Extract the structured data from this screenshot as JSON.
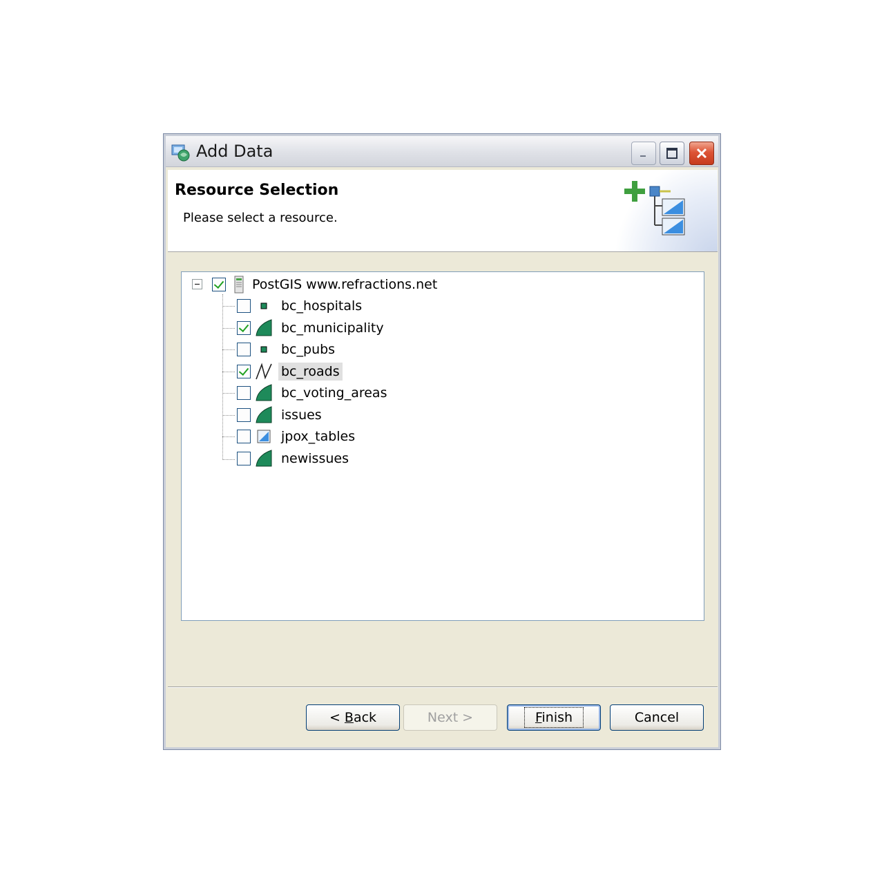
{
  "window": {
    "title": "Add Data"
  },
  "header": {
    "title": "Resource Selection",
    "description": "Please select a resource."
  },
  "tree": {
    "root": {
      "label": "PostGIS www.refractions.net",
      "checked": true,
      "expanded": true
    },
    "items": [
      {
        "label": "bc_hospitals",
        "checked": false,
        "icon": "point-layer-icon"
      },
      {
        "label": "bc_municipality",
        "checked": true,
        "icon": "polygon-layer-icon"
      },
      {
        "label": "bc_pubs",
        "checked": false,
        "icon": "point-layer-icon"
      },
      {
        "label": "bc_roads",
        "checked": true,
        "icon": "line-layer-icon",
        "selected": true
      },
      {
        "label": "bc_voting_areas",
        "checked": false,
        "icon": "polygon-layer-icon"
      },
      {
        "label": "issues",
        "checked": false,
        "icon": "polygon-layer-icon"
      },
      {
        "label": "jpox_tables",
        "checked": false,
        "icon": "generic-layer-icon"
      },
      {
        "label": "newissues",
        "checked": false,
        "icon": "polygon-layer-icon"
      }
    ]
  },
  "buttons": {
    "back": {
      "label_pre": "< ",
      "mnemonic": "B",
      "label_post": "ack"
    },
    "next": {
      "label": "Next >"
    },
    "finish": {
      "mnemonic": "F",
      "label_post": "inish"
    },
    "cancel": {
      "label": "Cancel"
    }
  }
}
